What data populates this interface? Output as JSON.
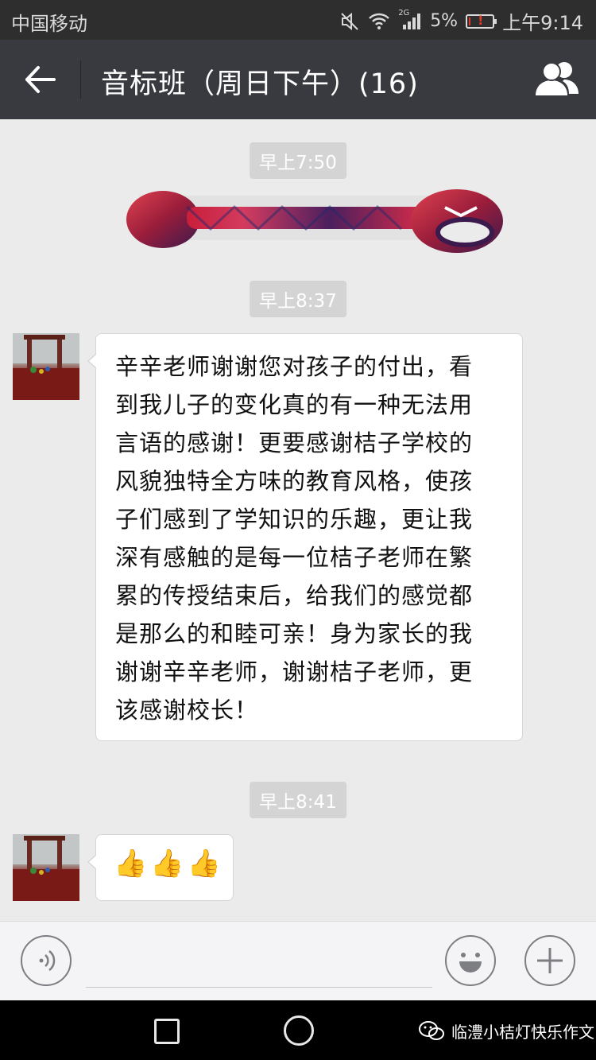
{
  "status_bar": {
    "carrier": "中国移动",
    "network": "2G",
    "battery_percent": "5%",
    "battery_level": 0.05,
    "time": "上午9:14",
    "icons": [
      "mute-icon",
      "wifi-icon",
      "signal-icon",
      "battery-low-icon"
    ]
  },
  "header": {
    "title": "音标班（周日下午）(16)",
    "back_icon": "back-arrow-icon",
    "members_icon": "group-members-icon"
  },
  "chat": {
    "timestamps": [
      "早上7:50",
      "早上8:37",
      "早上8:41"
    ],
    "sticker": "colorful-key-sticker",
    "message_lines": [
      "辛辛老师谢谢您对孩子的付出，看",
      "到我儿子的变化真的有一种无法用",
      "言语的感谢！更要感谢桔子学校的",
      "风貌独特全方味的教育风格，使孩",
      "子们感到了学知识的乐趣，更让我",
      "深有感触的是每一位桔子老师在繁",
      "累的传授结束后，给我们的感觉都",
      "是那么的和睦可亲！身为家长的我",
      "谢谢辛辛老师，谢谢桔子老师，更",
      "该感谢校长！"
    ],
    "emoji_message": [
      "👍",
      "👍",
      "👍"
    ]
  },
  "input_bar": {
    "voice_icon": "voice-icon",
    "emoji_icon": "smiley-icon",
    "more_icon": "plus-icon"
  },
  "nav_bar": {
    "watermark": "临澧小桔灯快乐作文",
    "icons": [
      "recent-apps-icon",
      "home-icon",
      "wechat-logo-icon"
    ]
  },
  "colors": {
    "status_bar": "#2e2e2e",
    "title_bar": "#393a3f",
    "chat_bg": "#ebebeb",
    "bubble": "#ffffff",
    "battery_warning": "#e23b2e"
  }
}
